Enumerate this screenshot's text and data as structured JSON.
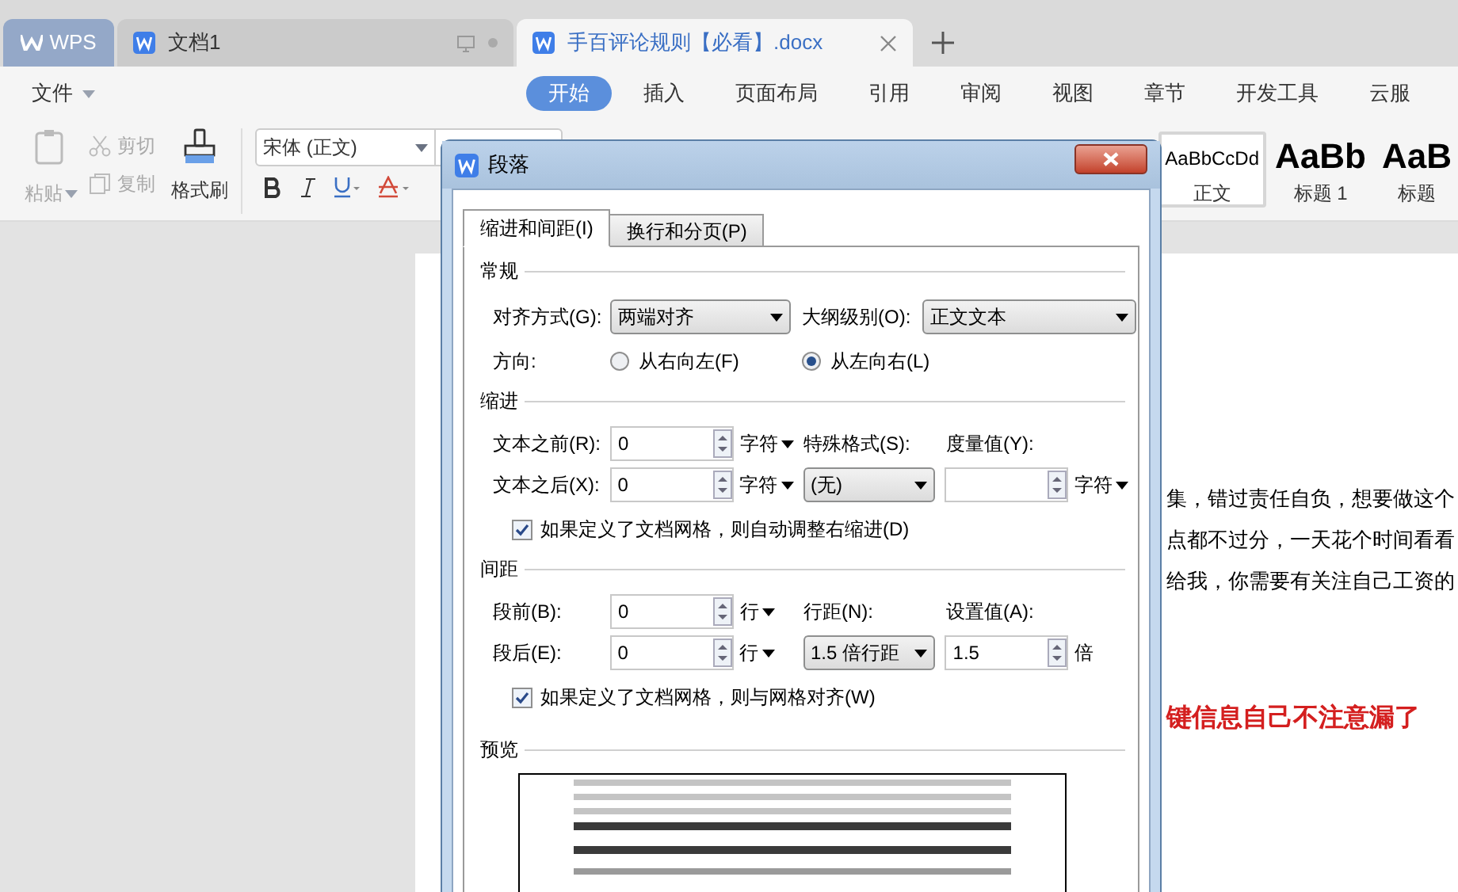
{
  "app_tabs": [
    {
      "kind": "home",
      "label": "WPS",
      "selected": false
    },
    {
      "kind": "doc",
      "label": "文档1",
      "selected": false
    },
    {
      "kind": "doc",
      "label": "手百评论规则【必看】.docx",
      "selected": true
    }
  ],
  "menu": {
    "label": "文件"
  },
  "ribbon_tabs": [
    {
      "label": "开始",
      "selected": true
    },
    {
      "label": "插入",
      "selected": false
    },
    {
      "label": "页面布局",
      "selected": false
    },
    {
      "label": "引用",
      "selected": false
    },
    {
      "label": "审阅",
      "selected": false
    },
    {
      "label": "视图",
      "selected": false
    },
    {
      "label": "章节",
      "selected": false
    },
    {
      "label": "开发工具",
      "selected": false
    },
    {
      "label": "云服",
      "selected": false
    }
  ],
  "clipboard": [
    {
      "kind": "paste",
      "label": "粘贴",
      "disabled": true
    },
    {
      "kind": "cut",
      "label": "剪切",
      "disabled": true
    },
    {
      "kind": "copy",
      "label": "复制",
      "disabled": true
    },
    {
      "kind": "brush",
      "label": "格式刷",
      "disabled": false
    }
  ],
  "font": {
    "name": "宋体 (正文)"
  },
  "styles": [
    {
      "preview": "AaBbCcDd",
      "label": "正文",
      "selected": true
    },
    {
      "preview": "AaBb",
      "label": "标题 1",
      "selected": false
    },
    {
      "preview": "AaB",
      "label": "标题",
      "selected": false
    }
  ],
  "document": {
    "lines": [
      {
        "kind": "normal",
        "text": "集，错过责任自负，想要做这个"
      },
      {
        "kind": "normal",
        "text": "点都不过分，一天花个时间看看"
      },
      {
        "kind": "normal",
        "text": "给我，你需要有关注自己工资的"
      },
      {
        "kind": "emphasis",
        "text": "键信息自己不注意漏了"
      }
    ]
  },
  "dialog": {
    "title": "段落",
    "tabs": [
      {
        "label": "缩进和间距(I)",
        "selected": true
      },
      {
        "label": "换行和分页(P)",
        "selected": false
      }
    ],
    "general": {
      "heading": "常规",
      "alignment": {
        "label": "对齐方式(G):",
        "value": "两端对齐"
      },
      "outline": {
        "label": "大纲级别(O):",
        "value": "正文文本"
      },
      "direction": {
        "label": "方向:",
        "options": [
          {
            "label": "从右向左(F)",
            "selected": false
          },
          {
            "label": "从左向右(L)",
            "selected": true
          }
        ]
      }
    },
    "indent": {
      "heading": "缩进",
      "before": {
        "label": "文本之前(R):",
        "value": "0",
        "unit": {
          "text": "字符",
          "menu": true
        }
      },
      "after": {
        "label": "文本之后(X):",
        "value": "0",
        "unit": {
          "text": "字符",
          "menu": true
        }
      },
      "special": {
        "label": "特殊格式(S):",
        "value": "(无)"
      },
      "measure": {
        "label": "度量值(Y):",
        "unit": {
          "text": "字符",
          "menu": true
        }
      },
      "auto_adjust": {
        "label": "如果定义了文档网格，则自动调整右缩进(D)",
        "checked": true
      }
    },
    "spacing": {
      "heading": "间距",
      "before": {
        "label": "段前(B):",
        "value": "0",
        "unit": {
          "text": "行",
          "menu": true
        }
      },
      "after": {
        "label": "段后(E):",
        "value": "0",
        "unit": {
          "text": "行",
          "menu": true
        }
      },
      "line": {
        "label": "行距(N):",
        "value": "1.5 倍行距"
      },
      "amount": {
        "label": "设置值(A):",
        "value": "1.5",
        "unit": {
          "text": "倍",
          "menu": false
        }
      },
      "snap": {
        "label": "如果定义了文档网格，则与网格对齐(W)",
        "checked": true
      }
    },
    "preview": {
      "heading": "预览"
    }
  }
}
